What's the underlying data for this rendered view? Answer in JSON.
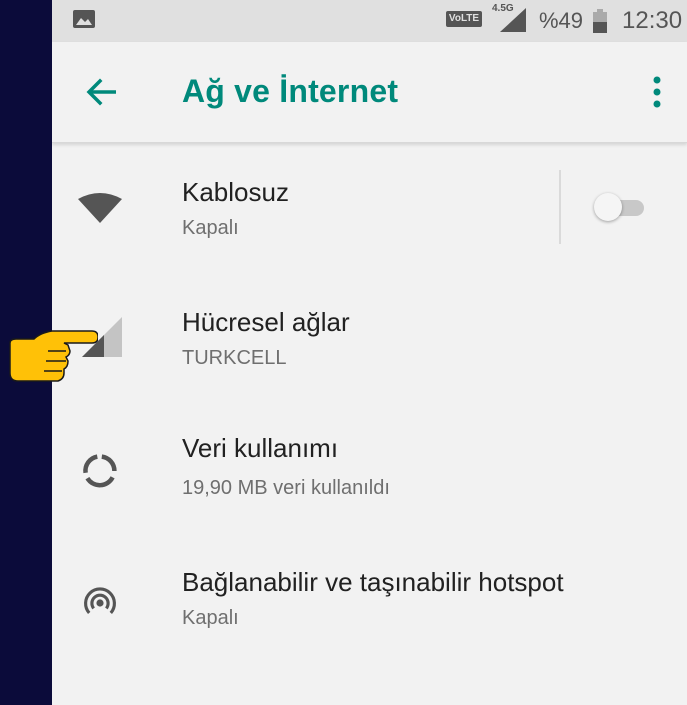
{
  "status_bar": {
    "volte": "VoLTE",
    "network": "4.5G",
    "battery": "%49",
    "time": "12:30"
  },
  "toolbar": {
    "title": "Ağ ve İnternet"
  },
  "items": [
    {
      "title": "Kablosuz",
      "subtitle": "Kapalı",
      "icon": "wifi-icon",
      "toggle": false
    },
    {
      "title": "Hücresel ağlar",
      "subtitle": "TURKCELL",
      "icon": "cellular-signal-icon"
    },
    {
      "title": "Veri kullanımı",
      "subtitle": "19,90 MB veri kullanıldı",
      "icon": "data-usage-icon"
    },
    {
      "title": "Bağlanabilir ve taşınabilir hotspot",
      "subtitle": "Kapalı",
      "icon": "hotspot-icon"
    }
  ],
  "colors": {
    "accent": "#00897b",
    "background": "#f2f2f2",
    "outer_background": "#0b0b3a",
    "pointer": "#ffc107"
  }
}
